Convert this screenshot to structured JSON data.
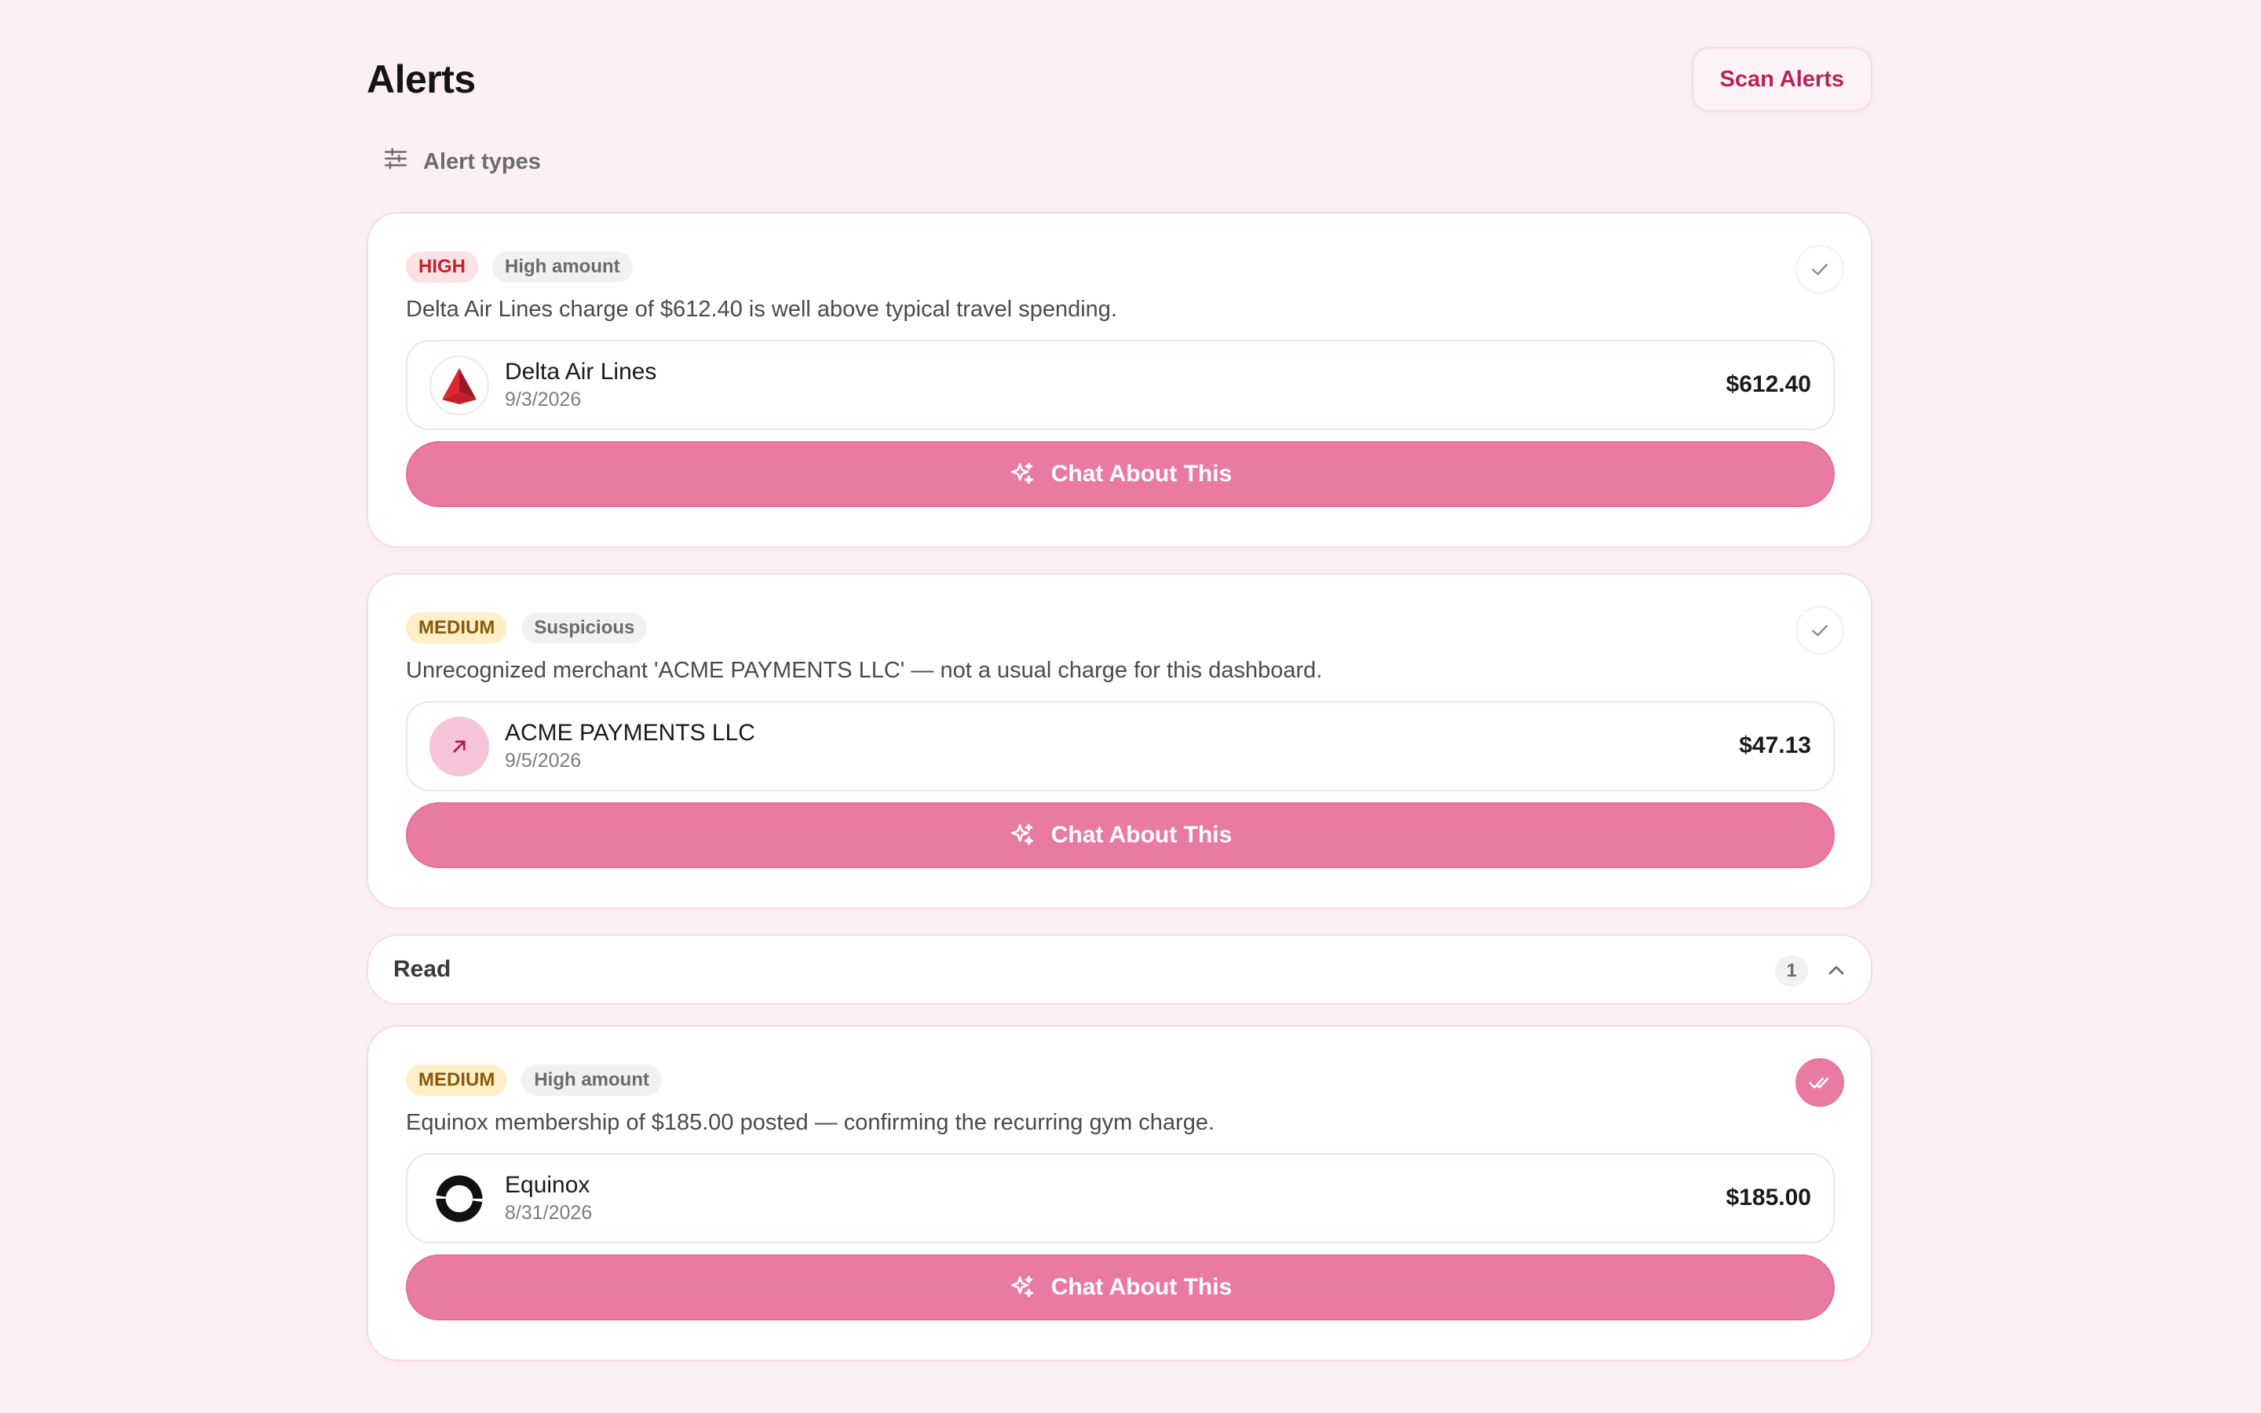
{
  "header": {
    "title": "Alerts",
    "scan_label": "Scan Alerts"
  },
  "filter": {
    "label": "Alert types",
    "icon": "sliders-icon"
  },
  "alerts": [
    {
      "severity": "HIGH",
      "type": "High amount",
      "description": "Delta Air Lines charge of $612.40 is well above typical travel spending.",
      "merchant": "Delta Air Lines",
      "date": "9/3/2026",
      "amount": "$612.40",
      "logo": "delta-logo",
      "chat_label": "Chat About This",
      "read": false
    },
    {
      "severity": "MEDIUM",
      "type": "Suspicious",
      "description": "Unrecognized merchant 'ACME PAYMENTS LLC' — not a usual charge for this dashboard.",
      "merchant": "ACME PAYMENTS LLC",
      "date": "9/5/2026",
      "amount": "$47.13",
      "logo": "arrow-up-right-icon",
      "chat_label": "Chat About This",
      "read": false
    }
  ],
  "read_section": {
    "label": "Read",
    "count": "1",
    "expanded": true
  },
  "read_alerts": [
    {
      "severity": "MEDIUM",
      "type": "High amount",
      "description": "Equinox membership of $185.00 posted — confirming the recurring gym charge.",
      "merchant": "Equinox",
      "date": "8/31/2026",
      "amount": "$185.00",
      "logo": "equinox-logo",
      "chat_label": "Chat About This",
      "read": true
    }
  ],
  "colors": {
    "background": "#fdf0f4",
    "accent": "#e97aa2",
    "accent_text": "#b3245a",
    "high_badge_bg": "#fde1e4",
    "high_badge_text": "#c0232f",
    "medium_badge_bg": "#fdf0c8",
    "medium_badge_text": "#8a5a0a"
  }
}
